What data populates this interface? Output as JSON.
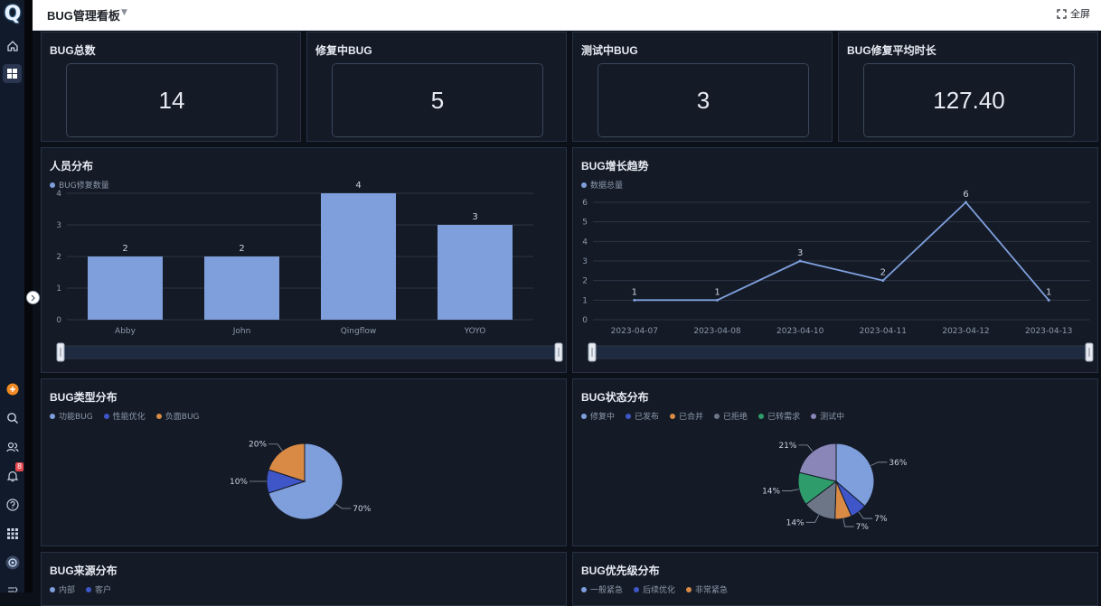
{
  "app": {
    "logo": "Q",
    "title": "BUG管理看板",
    "fullscreen_label": "全屏",
    "notification_count": "8"
  },
  "kpis": [
    {
      "title": "BUG总数",
      "value": "14"
    },
    {
      "title": "修复中BUG",
      "value": "5"
    },
    {
      "title": "测试中BUG",
      "value": "3"
    },
    {
      "title": "BUG修复平均时长",
      "value": "127.40"
    }
  ],
  "charts": {
    "person": {
      "title": "人员分布",
      "legend": [
        "BUG修复数量"
      ]
    },
    "trend": {
      "title": "BUG增长趋势",
      "legend": [
        "数据总量"
      ]
    },
    "type": {
      "title": "BUG类型分布",
      "legend": [
        "功能BUG",
        "性能优化",
        "负面BUG"
      ]
    },
    "status": {
      "title": "BUG状态分布",
      "legend": [
        "修复中",
        "已发布",
        "已合并",
        "已拒绝",
        "已转需求",
        "测试中"
      ]
    },
    "source": {
      "title": "BUG来源分布",
      "legend": [
        "内部",
        "客户"
      ]
    },
    "priority": {
      "title": "BUG优先级分布",
      "legend": [
        "一般紧急",
        "后续优化",
        "非常紧急"
      ]
    }
  },
  "colors": {
    "c1": "#7f9fdc",
    "c2": "#3f56c9",
    "c3": "#d98a45",
    "c4": "#6c7686",
    "c5": "#2e9c6b",
    "c6": "#8a86b8"
  },
  "chart_data": [
    {
      "type": "bar",
      "title": "人员分布",
      "categories": [
        "Abby",
        "John",
        "Qingflow",
        "YOYO"
      ],
      "series": [
        {
          "name": "BUG修复数量",
          "values": [
            2,
            2,
            4,
            3
          ]
        }
      ],
      "ylim": [
        0,
        4
      ],
      "yticks": [
        0,
        1,
        2,
        3,
        4
      ],
      "grid": true,
      "legend": "top-left"
    },
    {
      "type": "line",
      "title": "BUG增长趋势",
      "categories": [
        "2023-04-07",
        "2023-04-08",
        "2023-04-10",
        "2023-04-11",
        "2023-04-12",
        "2023-04-13"
      ],
      "series": [
        {
          "name": "数据总量",
          "values": [
            1,
            1,
            3,
            2,
            6,
            1
          ]
        }
      ],
      "ylim": [
        0,
        6
      ],
      "yticks": [
        0,
        1,
        2,
        3,
        4,
        5,
        6
      ],
      "grid": true,
      "legend": "top-left"
    },
    {
      "type": "pie",
      "title": "BUG类型分布",
      "labels": [
        "功能BUG",
        "性能优化",
        "负面BUG"
      ],
      "values": [
        70,
        10,
        20
      ],
      "value_labels": [
        "70%",
        "10%",
        "20%"
      ],
      "colors": [
        "#7f9fdc",
        "#3f56c9",
        "#d98a45"
      ]
    },
    {
      "type": "pie",
      "title": "BUG状态分布",
      "labels": [
        "修复中",
        "已发布",
        "已合并",
        "已拒绝",
        "已转需求",
        "测试中"
      ],
      "values": [
        36,
        7,
        7,
        14,
        14,
        21
      ],
      "value_labels": [
        "36%",
        "7%",
        "7%",
        "14%",
        "14%",
        "21%"
      ],
      "colors": [
        "#7f9fdc",
        "#3f56c9",
        "#d98a45",
        "#6c7686",
        "#2e9c6b",
        "#8a86b8"
      ]
    }
  ]
}
